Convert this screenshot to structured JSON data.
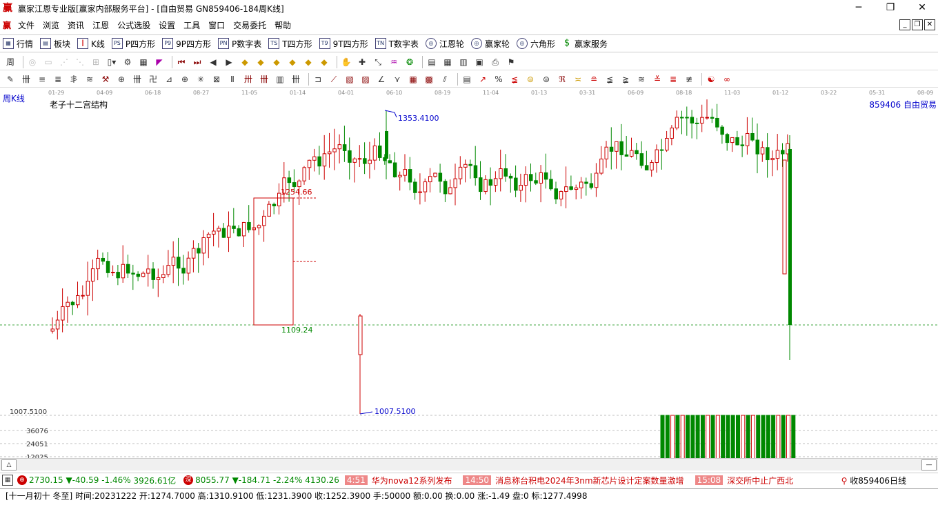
{
  "window": {
    "title": "赢家江恩专业版[赢家内部服务平台] - [自由贸易  GN859406-184周K线]",
    "logo": "赢"
  },
  "menu": {
    "logo": "赢",
    "items": [
      "文件",
      "浏览",
      "资讯",
      "江恩",
      "公式选股",
      "设置",
      "工具",
      "窗口",
      "交易委托",
      "帮助"
    ]
  },
  "nav": {
    "items": [
      {
        "icon": "quote-table-icon",
        "label": "行情"
      },
      {
        "icon": "sector-icon",
        "label": "板块"
      },
      {
        "icon": "kline-icon",
        "label": "K线"
      },
      {
        "icon": "p-square-icon",
        "label": "P四方形",
        "badge": "PS"
      },
      {
        "icon": "9p-square-icon",
        "label": "9P四方形",
        "badge": "P9"
      },
      {
        "icon": "p-number-table-icon",
        "label": "P数字表",
        "badge": "PN"
      },
      {
        "icon": "t-square-icon",
        "label": "T四方形",
        "badge": "TS"
      },
      {
        "icon": "9t-square-icon",
        "label": "9T四方形",
        "badge": "T9"
      },
      {
        "icon": "t-number-table-icon",
        "label": "T数字表",
        "badge": "TN"
      },
      {
        "icon": "gann-wheel-icon",
        "label": "江恩轮",
        "badge": "◎"
      },
      {
        "icon": "winner-wheel-icon",
        "label": "赢家轮",
        "badge": "◎"
      },
      {
        "icon": "hexagon-icon",
        "label": "六角形",
        "badge": "◎"
      },
      {
        "icon": "dollar-icon",
        "label": "赢家服务",
        "badge": "$"
      }
    ]
  },
  "chart": {
    "period_label": "周K线",
    "stock_name": "老子十二宫结构",
    "stock_code": "859406  自由贸易",
    "dates": [
      "01-29",
      "04-09",
      "06-18",
      "08-27",
      "11-05",
      "01-14",
      "04-01",
      "06-10",
      "08-19",
      "11-04",
      "01-13",
      "03-31",
      "06-09",
      "08-18",
      "11-03",
      "01-12",
      "03-22",
      "05-31",
      "08-09"
    ],
    "high_label": "1353.4100",
    "low_label": "1007.5100",
    "box_high_label": "1254.66",
    "box_low_label": "1109.24",
    "left_price_label": "1007.5100",
    "vol_ticks": [
      "36076",
      "24051",
      "12025"
    ],
    "colors": {
      "up": "#cc0000",
      "down": "#008800",
      "accent": "#0000cc"
    }
  },
  "index_bar": {
    "idx1": {
      "value": "2730.15",
      "change": "▼-40.59",
      "pct": "-1.46%",
      "amount": "3926.61亿"
    },
    "idx2": {
      "icon_text": "深",
      "value": "8055.77",
      "change": "▼-184.71",
      "pct": "-2.24%",
      "amount": "4130.26"
    },
    "news": [
      {
        "time": "4:51",
        "text": "华为nova12系列发布"
      },
      {
        "time": "14:50",
        "text": "消息称台积电2024年3nm新芯片设计定案数量激增"
      },
      {
        "time": "15:08",
        "text": "深交所中止广西北"
      }
    ],
    "right_label": "收859406日线"
  },
  "status": {
    "text": "[十一月初十 冬至] 时间:20231222 开:1274.7000 高:1310.9100 低:1231.3900 收:1252.3900 手:50000 额:0.00 换:0.00 涨:-1.49 盘:0 标:1277.4998"
  }
}
